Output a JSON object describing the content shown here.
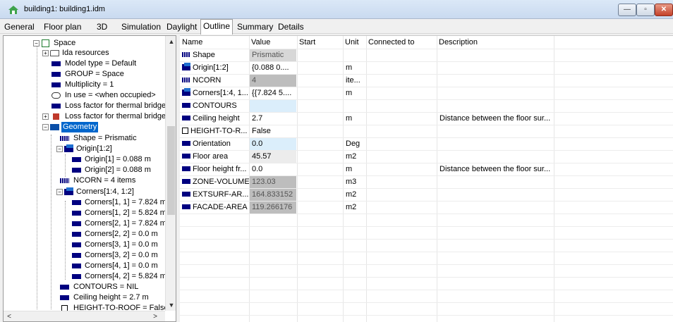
{
  "window": {
    "title": "building1: building1.idm",
    "min_glyph": "—",
    "max_glyph": "▫",
    "close_glyph": "✕"
  },
  "tabs": [
    "General",
    "Floor plan",
    "3D",
    "Simulation",
    "Daylight",
    "Outline",
    "Summary",
    "Details"
  ],
  "active_tab": "Outline",
  "tree": {
    "items": [
      {
        "label": "Space",
        "icon": "space-icon"
      },
      {
        "label": "Ida resources",
        "icon": "folder-icon"
      },
      {
        "label": "Model type = Default",
        "icon": "attribute-icon"
      },
      {
        "label": "GROUP = Space",
        "icon": "attribute-icon"
      },
      {
        "label": "Multiplicity = 1",
        "icon": "attribute-icon"
      },
      {
        "label": "In use = <when occupied>",
        "icon": "schedule-icon"
      },
      {
        "label": "Loss factor for thermal bridges",
        "icon": "attribute-icon"
      },
      {
        "label": "Loss factor for thermal bridges",
        "icon": "thermal-bridge-icon"
      },
      {
        "label": "Geometry",
        "icon": "folder-icon"
      },
      {
        "label": "Shape = Prismatic",
        "icon": "enum-icon"
      },
      {
        "label": "Origin[1:2]",
        "icon": "vector-icon"
      },
      {
        "label": "Origin[1] = 0.088 m",
        "icon": "attribute-icon"
      },
      {
        "label": "Origin[2] = 0.088 m",
        "icon": "attribute-icon"
      },
      {
        "label": "NCORN = 4 items",
        "icon": "enum-icon"
      },
      {
        "label": "Corners[1:4, 1:2]",
        "icon": "vector-icon"
      },
      {
        "label": "Corners[1, 1] = 7.824 m",
        "icon": "attribute-icon"
      },
      {
        "label": "Corners[1, 2] = 5.824 m",
        "icon": "attribute-icon"
      },
      {
        "label": "Corners[2, 1] = 7.824 m",
        "icon": "attribute-icon"
      },
      {
        "label": "Corners[2, 2] = 0.0 m",
        "icon": "attribute-icon"
      },
      {
        "label": "Corners[3, 1] = 0.0 m",
        "icon": "attribute-icon"
      },
      {
        "label": "Corners[3, 2] = 0.0 m",
        "icon": "attribute-icon"
      },
      {
        "label": "Corners[4, 1] = 0.0 m",
        "icon": "attribute-icon"
      },
      {
        "label": "Corners[4, 2] = 5.824 m",
        "icon": "attribute-icon"
      },
      {
        "label": "CONTOURS = NIL",
        "icon": "attribute-icon"
      },
      {
        "label": "Ceiling height = 2.7 m",
        "icon": "attribute-icon"
      },
      {
        "label": "HEIGHT-TO-ROOF = False",
        "icon": "checkbox-icon"
      }
    ],
    "selected": "Geometry",
    "scroll_up_glyph": "▲",
    "scroll_down_glyph": "▼",
    "scroll_left_glyph": "<",
    "scroll_right_glyph": ">"
  },
  "grid": {
    "columns": [
      "Name",
      "Value",
      "Start",
      "Unit",
      "Connected to",
      "Description"
    ],
    "rows": [
      {
        "name": "Shape",
        "value": "Prismatic",
        "start": "",
        "unit": "",
        "connected": "",
        "description": "",
        "icon": "enum-icon"
      },
      {
        "name": "Origin[1:2]",
        "value": "{0.088 0....",
        "start": "",
        "unit": "m",
        "connected": "",
        "description": "",
        "icon": "vector-icon"
      },
      {
        "name": "NCORN",
        "value": "4",
        "start": "",
        "unit": "ite...",
        "connected": "",
        "description": "",
        "icon": "enum-icon"
      },
      {
        "name": "Corners[1:4, 1...",
        "value": "{{7.824 5....",
        "start": "",
        "unit": "m",
        "connected": "",
        "description": "",
        "icon": "vector-icon"
      },
      {
        "name": "CONTOURS",
        "value": "",
        "start": "",
        "unit": "",
        "connected": "",
        "description": "",
        "icon": "attribute-icon"
      },
      {
        "name": "Ceiling height",
        "value": "2.7",
        "start": "",
        "unit": "m",
        "connected": "",
        "description": "Distance between the floor sur...",
        "icon": "attribute-icon"
      },
      {
        "name": "HEIGHT-TO-R...",
        "value": "False",
        "start": "",
        "unit": "",
        "connected": "",
        "description": "",
        "icon": "checkbox-icon"
      },
      {
        "name": "Orientation",
        "value": "0.0",
        "start": "",
        "unit": "Deg",
        "connected": "",
        "description": "",
        "icon": "attribute-icon"
      },
      {
        "name": "Floor area",
        "value": "45.57",
        "start": "",
        "unit": "m2",
        "connected": "",
        "description": "",
        "icon": "attribute-icon"
      },
      {
        "name": "Floor height fr...",
        "value": "0.0",
        "start": "",
        "unit": "m",
        "connected": "",
        "description": "Distance between the floor sur...",
        "icon": "attribute-icon"
      },
      {
        "name": "ZONE-VOLUME",
        "value": "123.03",
        "start": "",
        "unit": "m3",
        "connected": "",
        "description": "",
        "icon": "attribute-icon"
      },
      {
        "name": "EXTSURF-AR...",
        "value": "164.833152",
        "start": "",
        "unit": "m2",
        "connected": "",
        "description": "",
        "icon": "attribute-icon"
      },
      {
        "name": "FACADE-AREA",
        "value": "119.266176",
        "start": "",
        "unit": "m2",
        "connected": "",
        "description": "",
        "icon": "attribute-icon"
      }
    ]
  }
}
